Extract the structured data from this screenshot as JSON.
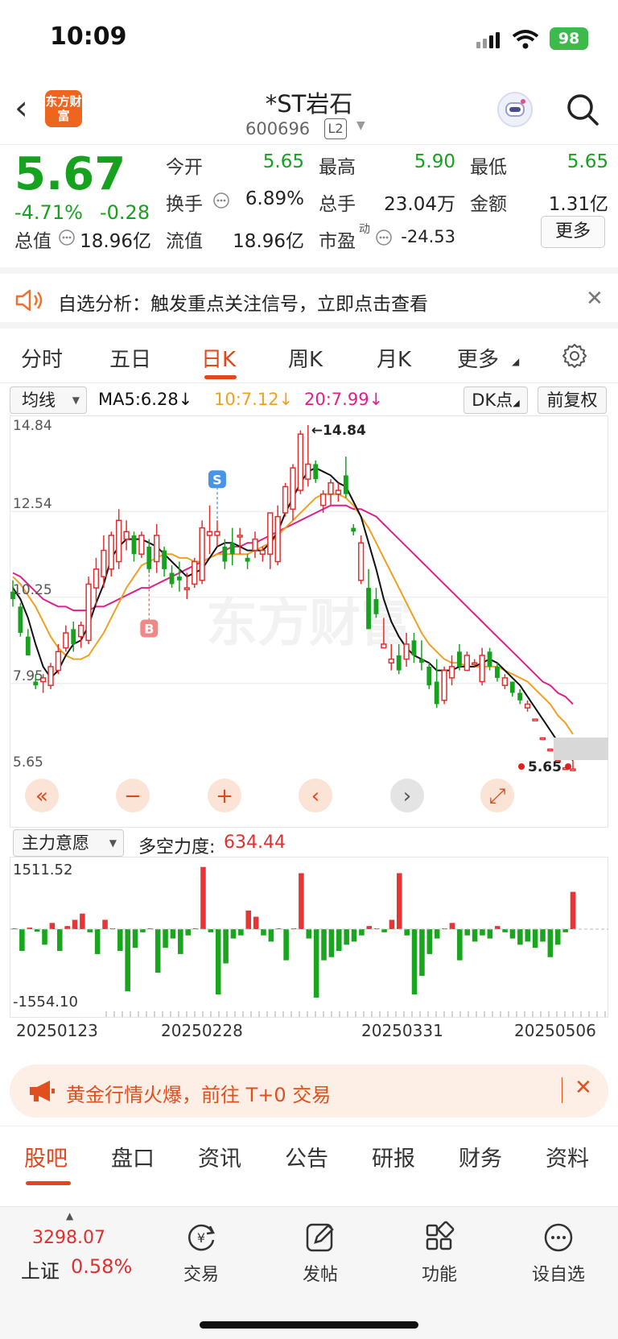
{
  "status": {
    "time": "10:09",
    "battery": "98"
  },
  "header": {
    "name": "*ST岩石",
    "code": "600696",
    "level": "L2",
    "logo": "东方财富"
  },
  "quote": {
    "price": "5.67",
    "pct": "-4.71%",
    "chg": "-0.28",
    "rows": [
      [
        {
          "label": "今开",
          "value": "5.65",
          "color": "#16a21f"
        },
        {
          "label": "最高",
          "value": "5.90",
          "color": "#16a21f"
        },
        {
          "label": "最低",
          "value": "5.65",
          "color": "#16a21f"
        }
      ],
      [
        {
          "label": "换手",
          "value": "6.89%",
          "color": "#222"
        },
        {
          "label": "总手",
          "value": "23.04万",
          "color": "#222"
        },
        {
          "label": "金额",
          "value": "1.31亿",
          "color": "#222"
        }
      ],
      [
        {
          "label": "流值",
          "value": "18.96亿",
          "color": "#222"
        },
        {
          "label": "市盈",
          "value": "-24.53",
          "color": "#222"
        }
      ]
    ],
    "total_label": "总值",
    "total_value": "18.96亿",
    "pe_sup": "动",
    "more": "更多"
  },
  "notice": {
    "text": "自选分析：触发重点关注信号，立即点击查看"
  },
  "tabs": [
    "分时",
    "五日",
    "日K",
    "周K",
    "月K",
    "更多"
  ],
  "ma": {
    "select": "均线",
    "ma5": "MA5:6.28↓",
    "ma10": "10:7.12↓",
    "ma20": "20:7.99↓",
    "dk": "DK点",
    "fq": "前复权",
    "ma5_color": "#111",
    "ma10_color": "#f0a020",
    "ma20_color": "#e0208a"
  },
  "chart_data": {
    "type": "candlestick",
    "y_ticks": [
      "14.84",
      "12.54",
      "10.25",
      "7.95",
      "5.65"
    ],
    "ylim": [
      5.65,
      14.84
    ],
    "high_label": "←14.84",
    "low_label": "5.65",
    "markers": {
      "buy": "B",
      "sell": "S"
    },
    "candles": [
      [
        10.4,
        10.7,
        10.0,
        10.2
      ],
      [
        10.0,
        10.1,
        9.2,
        9.3
      ],
      [
        9.2,
        9.4,
        8.7,
        8.7
      ],
      [
        8.0,
        8.2,
        7.8,
        7.9
      ],
      [
        8.0,
        8.2,
        7.7,
        8.1
      ],
      [
        7.9,
        8.5,
        7.8,
        8.4
      ],
      [
        8.3,
        9.0,
        8.2,
        8.8
      ],
      [
        8.9,
        9.5,
        8.8,
        9.3
      ],
      [
        9.4,
        9.6,
        8.8,
        9.0
      ],
      [
        9.2,
        9.6,
        8.9,
        9.5
      ],
      [
        9.1,
        10.8,
        9.0,
        10.6
      ],
      [
        10.5,
        11.3,
        10.0,
        11.0
      ],
      [
        10.8,
        11.9,
        10.5,
        11.5
      ],
      [
        11.0,
        12.0,
        10.8,
        11.9
      ],
      [
        11.2,
        12.6,
        11.0,
        12.3
      ],
      [
        11.8,
        12.3,
        11.5,
        12.0
      ],
      [
        11.9,
        12.0,
        11.2,
        11.4
      ],
      [
        11.4,
        12.0,
        11.3,
        11.9
      ],
      [
        11.6,
        11.8,
        10.9,
        11.0
      ],
      [
        11.2,
        12.2,
        10.9,
        11.9
      ],
      [
        11.5,
        11.6,
        10.8,
        11.0
      ],
      [
        10.9,
        11.1,
        10.5,
        10.6
      ],
      [
        10.8,
        11.2,
        10.4,
        10.7
      ],
      [
        10.5,
        10.9,
        10.2,
        10.5
      ],
      [
        10.6,
        11.3,
        10.5,
        11.2
      ],
      [
        10.7,
        12.3,
        10.6,
        12.1
      ],
      [
        11.9,
        12.7,
        11.4,
        12.0
      ],
      [
        11.9,
        12.3,
        11.6,
        12.0
      ],
      [
        11.6,
        11.8,
        11.0,
        11.2
      ],
      [
        11.7,
        12.1,
        11.1,
        11.4
      ],
      [
        11.9,
        12.1,
        11.4,
        11.9
      ],
      [
        11.3,
        11.4,
        11.0,
        11.2
      ],
      [
        11.5,
        12.0,
        11.3,
        11.8
      ],
      [
        11.4,
        11.6,
        11.2,
        11.5
      ],
      [
        11.4,
        12.5,
        11.0,
        12.5
      ],
      [
        11.2,
        12.7,
        11.1,
        12.4
      ],
      [
        12.5,
        13.3,
        12.4,
        13.2
      ],
      [
        12.6,
        13.8,
        12.3,
        13.7
      ],
      [
        13.1,
        14.7,
        13.0,
        14.6
      ],
      [
        13.4,
        14.84,
        13.2,
        13.8
      ],
      [
        13.8,
        13.9,
        13.3,
        13.4
      ],
      [
        12.7,
        13.1,
        12.5,
        13.0
      ],
      [
        13.0,
        13.4,
        12.7,
        13.3
      ],
      [
        13.0,
        13.3,
        12.8,
        13.1
      ],
      [
        13.5,
        14.0,
        12.9,
        13.0
      ],
      [
        12.1,
        12.2,
        11.9,
        12.0
      ],
      [
        10.7,
        11.9,
        10.6,
        11.7
      ],
      [
        10.5,
        11.0,
        9.4,
        9.4
      ],
      [
        10.2,
        10.5,
        9.7,
        9.8
      ],
      [
        8.9,
        9.7,
        8.9,
        9.0
      ],
      [
        8.5,
        9.0,
        8.3,
        8.6
      ],
      [
        8.7,
        9.0,
        8.2,
        8.3
      ],
      [
        8.6,
        9.3,
        8.4,
        9.0
      ],
      [
        9.1,
        9.3,
        8.5,
        8.7
      ],
      [
        8.6,
        9.1,
        8.3,
        8.5
      ],
      [
        8.4,
        8.5,
        7.8,
        7.9
      ],
      [
        8.0,
        8.6,
        7.3,
        7.4
      ],
      [
        7.5,
        8.4,
        7.4,
        8.3
      ],
      [
        8.1,
        8.7,
        7.9,
        8.4
      ],
      [
        8.8,
        9.0,
        8.3,
        8.4
      ],
      [
        8.3,
        8.8,
        8.3,
        8.7
      ],
      [
        8.5,
        8.6,
        8.4,
        8.5
      ],
      [
        8.0,
        8.9,
        7.9,
        8.7
      ],
      [
        8.8,
        8.9,
        8.3,
        8.4
      ],
      [
        8.4,
        8.5,
        8.0,
        8.1
      ],
      [
        7.9,
        8.2,
        7.8,
        8.1
      ],
      [
        8.0,
        8.0,
        7.6,
        7.7
      ],
      [
        7.7,
        7.8,
        7.4,
        7.5
      ],
      [
        7.3,
        7.5,
        7.2,
        7.4
      ],
      [
        7.0,
        7.0,
        7.0,
        7.0
      ],
      [
        6.5,
        6.5,
        6.5,
        6.5
      ],
      [
        6.2,
        6.2,
        6.2,
        6.2
      ],
      [
        5.9,
        5.9,
        5.9,
        5.9
      ],
      [
        5.7,
        5.7,
        5.7,
        5.7
      ],
      [
        5.67,
        5.9,
        5.65,
        5.67
      ]
    ],
    "ma5": [
      10.5,
      10.2,
      9.7,
      9.0,
      8.4,
      8.1,
      8.3,
      8.7,
      9.0,
      9.1,
      9.5,
      10.1,
      10.6,
      11.3,
      11.6,
      11.8,
      11.8,
      11.8,
      11.7,
      11.6,
      11.4,
      11.2,
      11.0,
      10.8,
      10.9,
      11.0,
      11.3,
      11.6,
      11.7,
      11.7,
      11.6,
      11.5,
      11.5,
      11.5,
      11.7,
      12.0,
      12.5,
      12.9,
      13.3,
      13.6,
      13.7,
      13.6,
      13.5,
      13.3,
      13.2,
      12.8,
      12.4,
      11.7,
      11.0,
      10.2,
      9.6,
      9.2,
      8.9,
      8.7,
      8.6,
      8.5,
      8.3,
      8.3,
      8.3,
      8.4,
      8.4,
      8.4,
      8.5,
      8.6,
      8.5,
      8.3,
      8.1,
      7.9,
      7.6,
      7.3,
      7.0,
      6.7,
      6.4,
      6.1,
      5.9
    ],
    "ma10": [
      10.8,
      10.6,
      10.3,
      10.0,
      9.6,
      9.2,
      8.9,
      8.7,
      8.6,
      8.6,
      8.7,
      9.0,
      9.3,
      9.7,
      10.1,
      10.5,
      10.8,
      11.1,
      11.2,
      11.3,
      11.4,
      11.4,
      11.3,
      11.3,
      11.2,
      11.2,
      11.3,
      11.4,
      11.4,
      11.4,
      11.4,
      11.4,
      11.5,
      11.6,
      11.7,
      11.9,
      12.1,
      12.3,
      12.5,
      12.7,
      12.9,
      13.0,
      13.0,
      13.0,
      12.9,
      12.7,
      12.4,
      12.1,
      11.7,
      11.3,
      10.9,
      10.5,
      10.1,
      9.7,
      9.3,
      9.0,
      8.8,
      8.6,
      8.5,
      8.5,
      8.4,
      8.4,
      8.4,
      8.4,
      8.4,
      8.3,
      8.2,
      8.1,
      8.0,
      7.8,
      7.6,
      7.4,
      7.1,
      6.9,
      6.6
    ],
    "ma20": [
      10.9,
      10.8,
      10.6,
      10.4,
      10.2,
      10.1,
      10.0,
      10.0,
      9.9,
      9.9,
      9.9,
      10.0,
      10.0,
      10.1,
      10.2,
      10.3,
      10.4,
      10.5,
      10.5,
      10.6,
      10.7,
      10.8,
      10.9,
      11.0,
      11.1,
      11.2,
      11.3,
      11.4,
      11.5,
      11.6,
      11.6,
      11.7,
      11.7,
      11.8,
      11.9,
      12.0,
      12.1,
      12.2,
      12.3,
      12.4,
      12.5,
      12.6,
      12.7,
      12.7,
      12.7,
      12.6,
      12.6,
      12.5,
      12.4,
      12.2,
      12.0,
      11.8,
      11.6,
      11.4,
      11.2,
      11.0,
      10.8,
      10.6,
      10.4,
      10.2,
      10.0,
      9.8,
      9.6,
      9.4,
      9.2,
      9.0,
      8.8,
      8.6,
      8.4,
      8.2,
      8.0,
      7.9,
      7.7,
      7.6,
      7.4
    ],
    "force": [
      20,
      -700,
      50,
      -80,
      -500,
      200,
      -700,
      100,
      300,
      500,
      -100,
      -800,
      300,
      0,
      -700,
      -2000,
      -600,
      -100,
      0,
      -1400,
      -600,
      -300,
      -800,
      -200,
      0,
      2000,
      -100,
      -2100,
      -1100,
      -300,
      -200,
      600,
      400,
      -200,
      -400,
      0,
      -1000,
      0,
      1800,
      -300,
      -2200,
      -1000,
      -900,
      -700,
      -500,
      -400,
      -200,
      100,
      0,
      -100,
      300,
      1800,
      -200,
      -2100,
      -1500,
      -800,
      -300,
      0,
      200,
      -1000,
      -200,
      -400,
      -200,
      -300,
      100,
      -100,
      -300,
      -500,
      -400,
      -600,
      -400,
      -900,
      -500,
      -100,
      1200
    ],
    "vol_top": "1511.52",
    "vol_bottom": "-1554.10",
    "dates": [
      "20250123",
      "20250228",
      "20250331",
      "20250506"
    ]
  },
  "indicator": {
    "select": "主力意愿",
    "label": "多空力度:",
    "value": "634.44"
  },
  "promo": {
    "text": "黄金行情火爆，前往 T+0 交易"
  },
  "bottom_tabs": [
    "股吧",
    "盘口",
    "资讯",
    "公告",
    "研报",
    "财务",
    "资料"
  ],
  "bottom_nav": {
    "index_value": "3298.07",
    "index_name": "上证",
    "index_pct": "0.58%",
    "items": [
      "交易",
      "发帖",
      "功能",
      "设自选"
    ]
  }
}
